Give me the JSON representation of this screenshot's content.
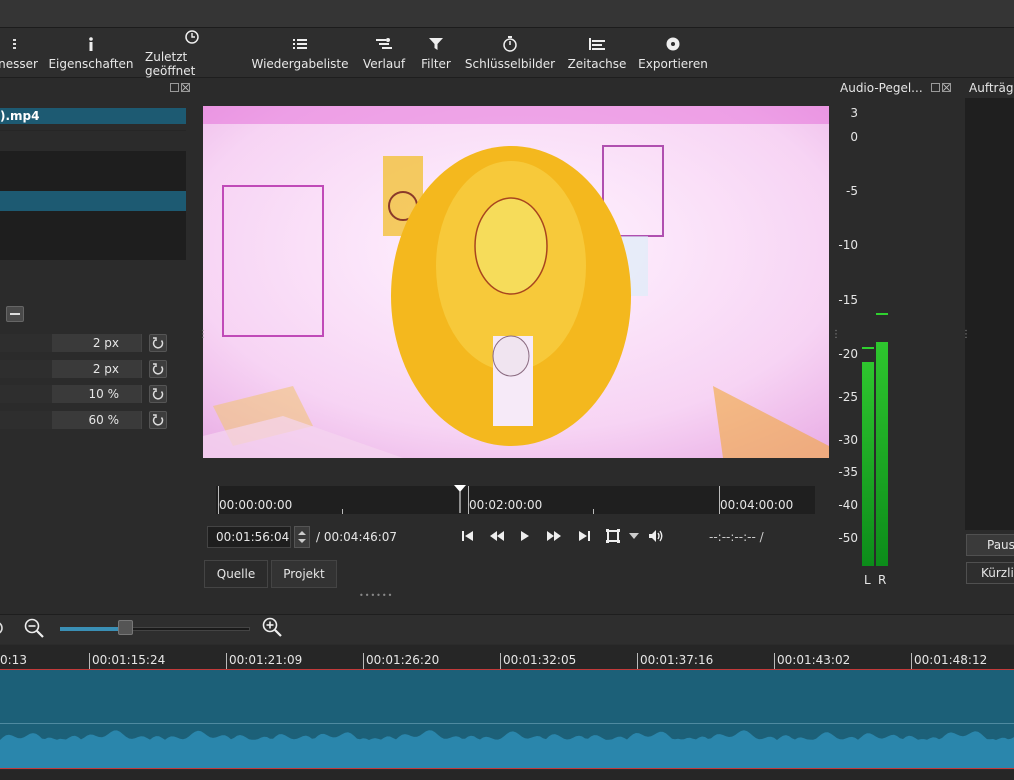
{
  "toolbar": {
    "items": [
      {
        "label": "nesser",
        "icon": "meter-icon"
      },
      {
        "label": "Eigenschaften",
        "icon": "info-icon"
      },
      {
        "label": "Zuletzt geöffnet",
        "icon": "clock-icon"
      },
      {
        "label": "Wiedergabeliste",
        "icon": "list-icon"
      },
      {
        "label": "Verlauf",
        "icon": "history-icon"
      },
      {
        "label": "Filter",
        "icon": "funnel-icon"
      },
      {
        "label": "Schlüsselbilder",
        "icon": "stopwatch-icon"
      },
      {
        "label": "Zeitachse",
        "icon": "timeline-icon"
      },
      {
        "label": "Exportieren",
        "icon": "disc-icon"
      }
    ]
  },
  "filters": {
    "clip_title": ").mp4",
    "params": [
      {
        "value": "2 px"
      },
      {
        "value": "2 px"
      },
      {
        "value": "10 %"
      },
      {
        "value": "60 %"
      }
    ]
  },
  "player": {
    "ruler_labels": [
      "00:00:00:00",
      "00:02:00:00",
      "00:04:00:00"
    ],
    "current_timecode": "00:01:56:04",
    "total_duration": "/ 00:04:46:07",
    "in_out": "--:--:--:-- /",
    "tabs": [
      "Quelle",
      "Projekt"
    ]
  },
  "audio": {
    "title": "Audio-Pegel...",
    "scale": [
      "3",
      "0",
      "-5",
      "-10",
      "-15",
      "-20",
      "-25",
      "-30",
      "-35",
      "-40",
      "-50"
    ],
    "left_label": "L",
    "right_label": "R",
    "left_level_db": -21,
    "right_level_db": -19
  },
  "jobs": {
    "title": "Aufträge",
    "pause_label": "Paus",
    "recent_label": "Kürzlic"
  },
  "timeline": {
    "ruler_labels": [
      "0:13",
      "00:01:15:24",
      "00:01:21:09",
      "00:01:26:20",
      "00:01:32:05",
      "00:01:37:16",
      "00:01:43:02",
      "00:01:48:12"
    ],
    "zoom_fraction": 0.34
  },
  "colors": {
    "accent": "#1d5a72",
    "track": "#1c6078",
    "meter": "#2ec62e"
  }
}
